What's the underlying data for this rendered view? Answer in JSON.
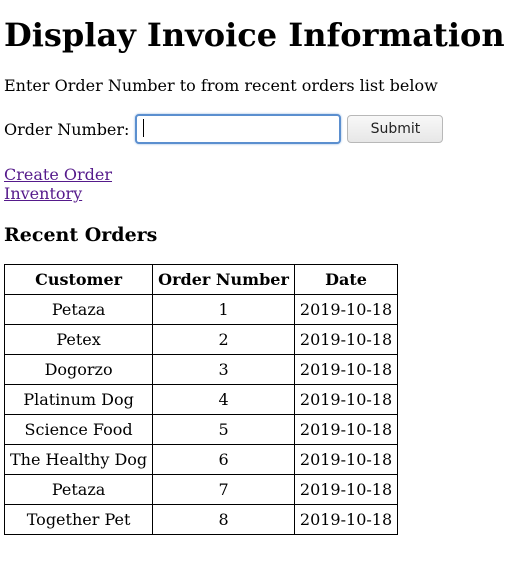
{
  "page": {
    "title": "Display Invoice Information",
    "instructions": "Enter Order Number to from recent orders list below"
  },
  "form": {
    "label": "Order Number:",
    "input_value": "",
    "submit_label": "Submit"
  },
  "links": {
    "create_order": "Create Order",
    "inventory": "Inventory"
  },
  "recent_orders": {
    "title": "Recent Orders",
    "columns": [
      "Customer",
      "Order Number",
      "Date"
    ],
    "rows": [
      [
        "Petaza",
        "1",
        "2019-10-18"
      ],
      [
        "Petex",
        "2",
        "2019-10-18"
      ],
      [
        "Dogorzo",
        "3",
        "2019-10-18"
      ],
      [
        "Platinum Dog",
        "4",
        "2019-10-18"
      ],
      [
        "Science Food",
        "5",
        "2019-10-18"
      ],
      [
        "The Healthy Dog",
        "6",
        "2019-10-18"
      ],
      [
        "Petaza",
        "7",
        "2019-10-18"
      ],
      [
        "Together Pet",
        "8",
        "2019-10-18"
      ]
    ]
  },
  "colors": {
    "link": "#551a8b",
    "input_focus_border": "#5b8fcf"
  }
}
